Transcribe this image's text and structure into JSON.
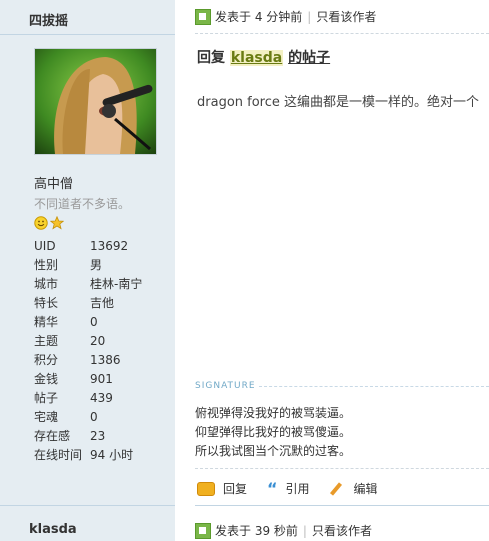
{
  "post1": {
    "author": "四拔摇",
    "rank": "高中僧",
    "custom_title": "不同道者不多语。",
    "stats": [
      {
        "label": "UID",
        "value": "13692"
      },
      {
        "label": "性别",
        "value": "男"
      },
      {
        "label": "城市",
        "value": "桂林-南宁"
      },
      {
        "label": "特长",
        "value": "吉他"
      },
      {
        "label": "精华",
        "value": "0"
      },
      {
        "label": "主题",
        "value": "20"
      },
      {
        "label": "积分",
        "value": "1386"
      },
      {
        "label": "金钱",
        "value": "901"
      },
      {
        "label": "帖子",
        "value": "439"
      },
      {
        "label": "宅魂",
        "value": "0"
      },
      {
        "label": "存在感",
        "value": "23"
      },
      {
        "label": "在线时间",
        "value": "94 小时"
      }
    ],
    "posted": "发表于 4 分钟前",
    "only_author": "只看该作者",
    "title_prefix": "回复",
    "title_user": "klasda",
    "title_suffix": "的帖子",
    "content": "dragon force 这编曲都是一模一样的。绝对一个",
    "signature_label": "SIGNATURE",
    "signature": [
      "俯视弹得没我好的被骂装逼。",
      "仰望弹得比我好的被骂傻逼。",
      "所以我试图当个沉默的过客。"
    ],
    "actions": {
      "reply": "回复",
      "quote": "引用",
      "edit": "编辑"
    }
  },
  "post2": {
    "author": "klasda",
    "posted": "发表于 39 秒前",
    "only_author": "只看该作者"
  },
  "icons": {
    "post": "post-icon",
    "smile": "smile-medal-icon",
    "star": "star-medal-icon",
    "reply": "reply-icon",
    "quote": "quote-icon",
    "edit": "edit-icon"
  },
  "colors": {
    "sidebar_bg": "#e5edf2",
    "link_user": "#6a7b12",
    "signature_label": "#72a9c7"
  }
}
